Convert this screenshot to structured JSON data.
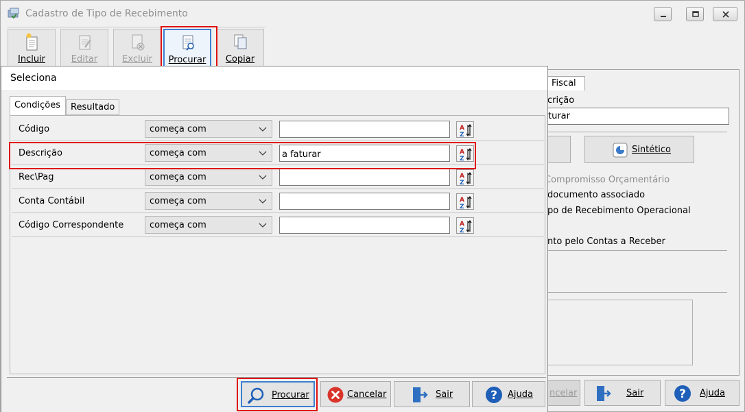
{
  "window": {
    "title": "Cadastro de Tipo de Recebimento"
  },
  "toolbar": {
    "incluir": "Incluir",
    "editar": "Editar",
    "excluir": "Excluir",
    "procurar": "Procurar",
    "copiar": "Copiar"
  },
  "background_form": {
    "tab_fiscal": "Fiscal",
    "descricao_label_partial": "crição",
    "descricao_value_partial": "turar",
    "sintetico_button": "Sintético",
    "compromisso": "Compromisso Orçamentário",
    "documento": "documento associado",
    "tipo_operacional": "po de Recebimento Operacional",
    "contas_receber": "nto pelo Contas a Receber",
    "cancelar_partial": "ncelar",
    "sair": "Sair",
    "ajuda": "Ajuda"
  },
  "dialog": {
    "title": "Seleciona",
    "tabs": [
      "Condições",
      "Resultado"
    ],
    "rows": [
      {
        "label": "Código",
        "operator": "começa com",
        "value": ""
      },
      {
        "label": "Descrição",
        "operator": "começa com",
        "value": "a faturar"
      },
      {
        "label": "Rec\\Pag",
        "operator": "começa com",
        "value": ""
      },
      {
        "label": "Conta Contábil",
        "operator": "começa com",
        "value": ""
      },
      {
        "label": "Código Correspondente",
        "operator": "começa com",
        "value": ""
      }
    ],
    "buttons": {
      "procurar": "Procurar",
      "cancelar": "Cancelar",
      "sair": "Sair",
      "ajuda": "Ajuda"
    }
  },
  "colors": {
    "highlight": "#e01010",
    "focus_blue": "#3c7fd0"
  }
}
